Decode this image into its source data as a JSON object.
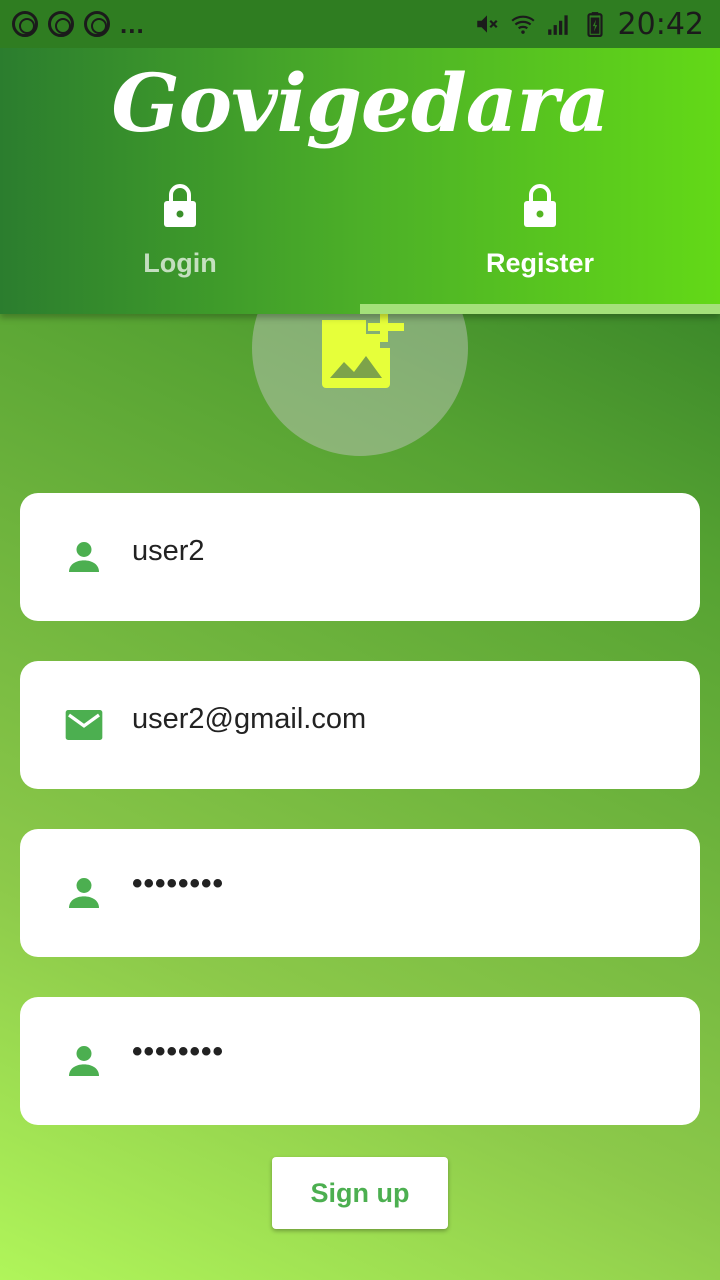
{
  "status_bar": {
    "time": "20:42",
    "notification_icons": [
      "notification-icon",
      "notification-icon",
      "notification-icon"
    ],
    "more_indicator": "...",
    "right_icons": [
      "mute-icon",
      "wifi-icon",
      "signal-icon",
      "battery-icon"
    ]
  },
  "app_bar": {
    "title": "Govigedara",
    "tabs": [
      {
        "label": "Login",
        "icon": "lock-icon",
        "selected": false
      },
      {
        "label": "Register",
        "icon": "lock-icon",
        "selected": true
      }
    ]
  },
  "avatar": {
    "icon": "add-photo-icon"
  },
  "form": {
    "username": {
      "icon": "person-icon",
      "value": "user2"
    },
    "email": {
      "icon": "email-icon",
      "value": "user2@gmail.com"
    },
    "password": {
      "icon": "person-icon",
      "value": "••••••••"
    },
    "confirm_password": {
      "icon": "person-icon",
      "value": "••••••••"
    }
  },
  "signup_button": {
    "label": "Sign up"
  },
  "colors": {
    "accent_green": "#4caf50",
    "icon_yellow": "#e6ff3a",
    "tab_indicator": "#a4e17a"
  }
}
